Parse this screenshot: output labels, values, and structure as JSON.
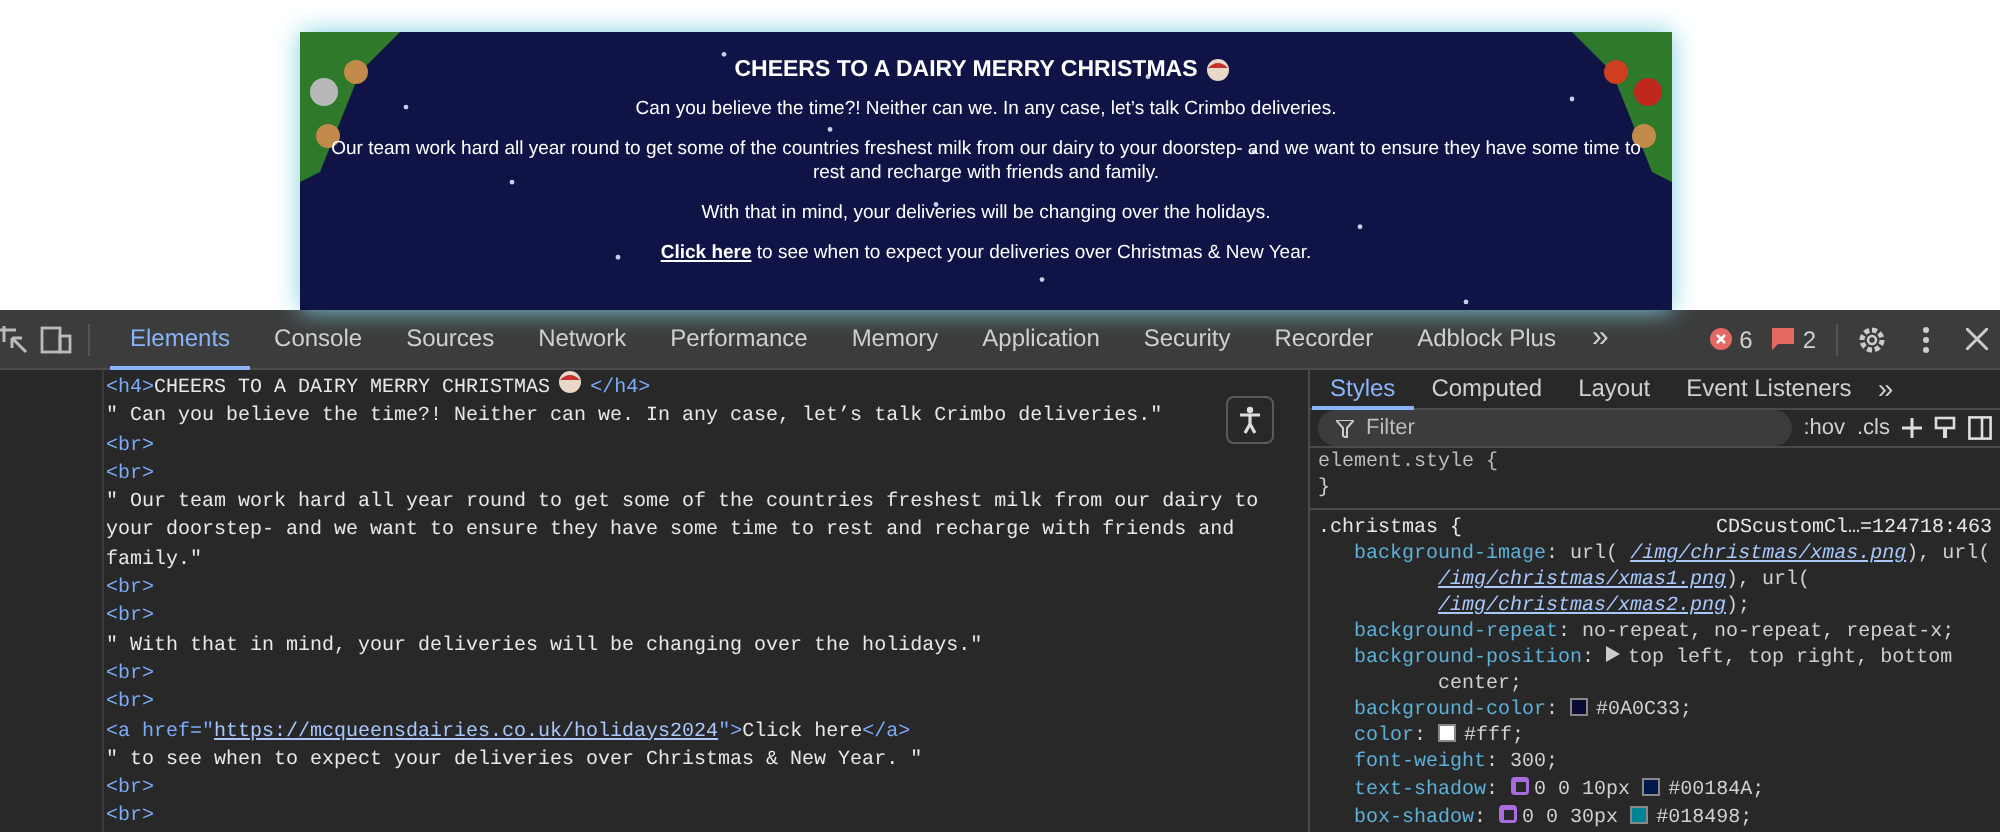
{
  "banner": {
    "title": "CHEERS TO A DAIRY MERRY CHRISTMAS",
    "paragraphs": [
      "Can you believe the time?! Neither can we. In any case, let’s talk Crimbo deliveries.",
      "Our team work hard all year round to get some of the countries freshest milk from our dairy to your doorstep- and we want to ensure they have some time to rest and recharge with friends and family.",
      "With that in mind, your deliveries will be changing over the holidays."
    ],
    "link": "Click here",
    "link_rest": "to see when to expect your deliveries over Christmas & New Year."
  },
  "toolbar": {
    "tabs": [
      {
        "label": "Elements",
        "selected": true
      },
      {
        "label": "Console",
        "selected": false
      },
      {
        "label": "Sources",
        "selected": false
      },
      {
        "label": "Network",
        "selected": false
      },
      {
        "label": "Performance",
        "selected": false
      },
      {
        "label": "Memory",
        "selected": false
      },
      {
        "label": "Application",
        "selected": false
      },
      {
        "label": "Security",
        "selected": false
      },
      {
        "label": "Recorder",
        "selected": false
      },
      {
        "label": "Adblock Plus",
        "selected": false
      }
    ],
    "more": "»",
    "errors": "6",
    "warnings": "2"
  },
  "elements": [
    {
      "segments": [
        {
          "kind": "tag",
          "text": "<h4>"
        },
        {
          "kind": "text",
          "text": "CHEERS TO A DAIRY MERRY CHRISTMAS"
        },
        {
          "kind": "emoji"
        },
        {
          "kind": "tag",
          "text": "</h4>"
        }
      ]
    },
    {
      "segments": [
        {
          "kind": "text",
          "text": "\" Can you believe the time?! Neither can we. In any case, let’s talk Crimbo deliveries.\""
        }
      ]
    },
    {
      "segments": [
        {
          "kind": "tag",
          "text": "<br>"
        }
      ]
    },
    {
      "segments": [
        {
          "kind": "tag",
          "text": "<br>"
        }
      ]
    },
    {
      "segments": [
        {
          "kind": "text",
          "text": "\" Our team work hard all year round to get some of the countries freshest milk from our dairy to your doorstep- and we want to ensure they have some time to rest and recharge with friends and family.\""
        }
      ]
    },
    {
      "segments": [
        {
          "kind": "tag",
          "text": "<br>"
        }
      ]
    },
    {
      "segments": [
        {
          "kind": "tag",
          "text": "<br>"
        }
      ]
    },
    {
      "segments": [
        {
          "kind": "text",
          "text": "\" With that in mind, your deliveries will be changing over the holidays.\""
        }
      ]
    },
    {
      "segments": [
        {
          "kind": "tag",
          "text": "<br>"
        }
      ]
    },
    {
      "segments": [
        {
          "kind": "tag",
          "text": "<br>"
        }
      ]
    },
    {
      "segments": [
        {
          "kind": "tag",
          "text": "<a href=\""
        },
        {
          "kind": "url",
          "text": "https://mcqueensdairies.co.uk/holidays2024"
        },
        {
          "kind": "tag",
          "text": "\">"
        },
        {
          "kind": "text",
          "text": "Click here"
        },
        {
          "kind": "tag",
          "text": "</a>"
        }
      ]
    },
    {
      "segments": [
        {
          "kind": "text",
          "text": "\" to see when to expect your deliveries over Christmas & New Year. \""
        }
      ]
    },
    {
      "segments": [
        {
          "kind": "tag",
          "text": "<br>"
        }
      ]
    },
    {
      "segments": [
        {
          "kind": "tag",
          "text": "<br>"
        }
      ]
    }
  ],
  "styles": {
    "tabs": [
      {
        "label": "Styles",
        "selected": true
      },
      {
        "label": "Computed",
        "selected": false
      },
      {
        "label": "Layout",
        "selected": false
      },
      {
        "label": "Event Listeners",
        "selected": false
      }
    ],
    "more": "»",
    "filter_placeholder": "Filter",
    "hov": ":hov",
    "cls": ".cls",
    "element_style": "element.style {",
    "close_brace": "}",
    "rule": {
      "selector": ".christmas {",
      "separator": ":",
      "source": "CDScustomCl…=124718:463",
      "declarations": [
        {
          "property": "background-image",
          "parts": [
            {
              "kind": "text",
              "text": "url("
            },
            {
              "kind": "url",
              "text": "/img/christmas/xmas.png"
            },
            {
              "kind": "text",
              "text": "), url("
            },
            {
              "kind": "url",
              "text": "/img/christmas/xmas1.png"
            },
            {
              "kind": "text",
              "text": "), url("
            },
            {
              "kind": "url",
              "text": "/img/christmas/xmas2.png"
            },
            {
              "kind": "text",
              "text": ");"
            }
          ]
        },
        {
          "property": "background-repeat",
          "parts": [
            {
              "kind": "text",
              "text": "no-repeat, no-repeat, repeat-x;"
            }
          ]
        },
        {
          "property": "background-position",
          "parts": [
            {
              "kind": "triangle"
            },
            {
              "kind": "text",
              "text": "top left, top right, bottom"
            },
            {
              "kind": "text",
              "text": "center;"
            }
          ]
        },
        {
          "property": "background-color",
          "parts": [
            {
              "kind": "swatch",
              "color": "#0a0c33"
            },
            {
              "kind": "text",
              "text": "#0A0C33;"
            }
          ]
        },
        {
          "property": "color",
          "parts": [
            {
              "kind": "swatch",
              "color": "#ffffff"
            },
            {
              "kind": "text",
              "text": "#fff;"
            }
          ]
        },
        {
          "property": "font-weight",
          "parts": [
            {
              "kind": "text",
              "text": "300;"
            }
          ]
        },
        {
          "property": "text-shadow",
          "parts": [
            {
              "kind": "shadow"
            },
            {
              "kind": "text",
              "text": "0 0 10px"
            },
            {
              "kind": "swatch",
              "color": "#00184a"
            },
            {
              "kind": "text",
              "text": "#00184A;"
            }
          ]
        },
        {
          "property": "box-shadow",
          "parts": [
            {
              "kind": "shadow"
            },
            {
              "kind": "text",
              "text": "0 0 30px"
            },
            {
              "kind": "swatch",
              "color": "#018498"
            },
            {
              "kind": "text",
              "text": "#018498;"
            }
          ]
        }
      ]
    }
  }
}
